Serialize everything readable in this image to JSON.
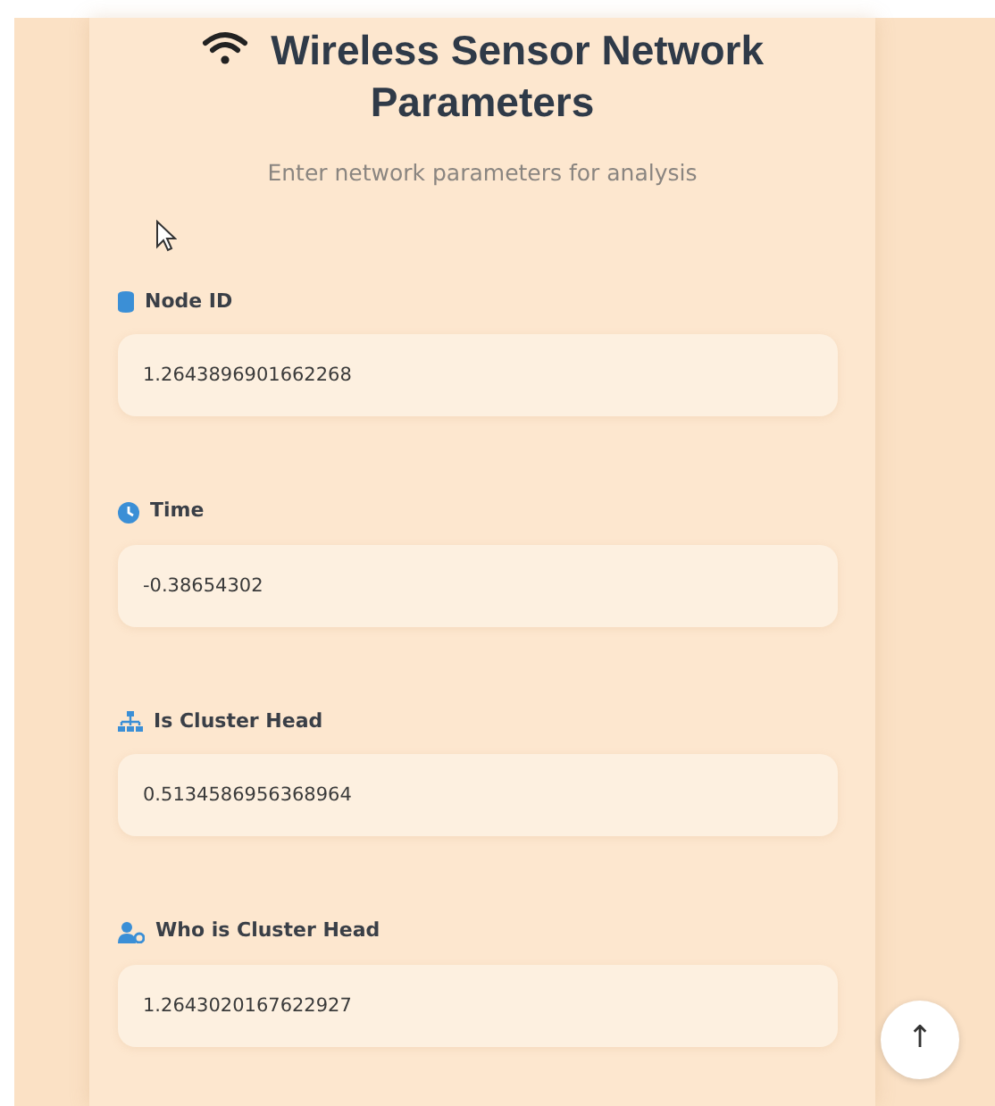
{
  "header": {
    "title": "Wireless Sensor Network Parameters",
    "subtitle": "Enter network parameters for analysis"
  },
  "fields": [
    {
      "label": "Node ID",
      "value": "1.2643896901662268"
    },
    {
      "label": "Time",
      "value": "-0.38654302"
    },
    {
      "label": "Is Cluster Head",
      "value": "0.5134586956368964"
    },
    {
      "label": "Who is Cluster Head",
      "value": "1.2643020167622927"
    }
  ],
  "scroll_top_button": {
    "label": "↑"
  }
}
